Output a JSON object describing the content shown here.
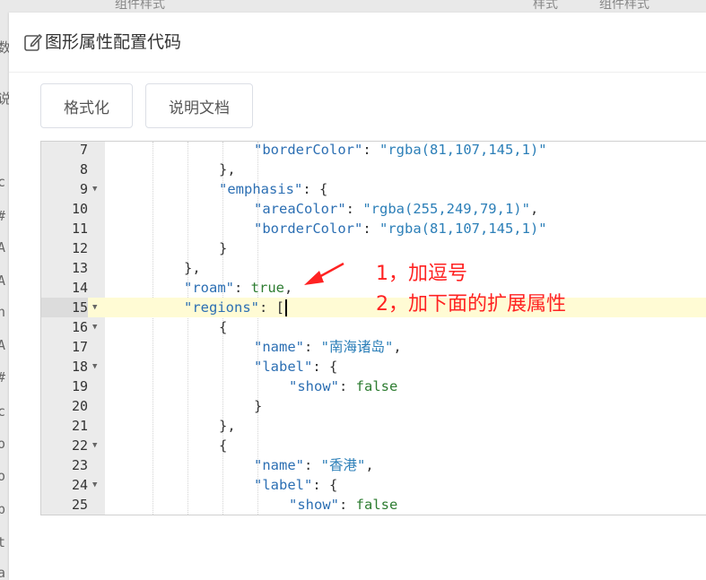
{
  "background": {
    "top_fragments": [
      "组件样式",
      "样式",
      "组件样式"
    ],
    "side_chars": [
      "数",
      "说",
      "c",
      "#",
      "A",
      "A",
      "n",
      "A",
      "#",
      "c",
      "o",
      "o",
      "p",
      "t",
      "a"
    ]
  },
  "dialog": {
    "title": "图形属性配置代码",
    "buttons": {
      "format": "格式化",
      "docs": "说明文档"
    }
  },
  "editor": {
    "active_line": 15,
    "lines": [
      {
        "num": "7",
        "fold": false,
        "parts": [
          [
            "k",
            "\"borderColor\""
          ],
          [
            "p",
            ": "
          ],
          [
            "v",
            "\"rgba(81,107,145,1)\""
          ]
        ],
        "indent": 16
      },
      {
        "num": "8",
        "fold": false,
        "parts": [
          [
            "p",
            "},"
          ]
        ],
        "indent": 12
      },
      {
        "num": "9",
        "fold": true,
        "parts": [
          [
            "k",
            "\"emphasis\""
          ],
          [
            "p",
            ": {"
          ]
        ],
        "indent": 12
      },
      {
        "num": "10",
        "fold": false,
        "parts": [
          [
            "k",
            "\"areaColor\""
          ],
          [
            "p",
            ": "
          ],
          [
            "v",
            "\"rgba(255,249,79,1)\""
          ],
          [
            "p",
            ","
          ]
        ],
        "indent": 16
      },
      {
        "num": "11",
        "fold": false,
        "parts": [
          [
            "k",
            "\"borderColor\""
          ],
          [
            "p",
            ": "
          ],
          [
            "v",
            "\"rgba(81,107,145,1)\""
          ]
        ],
        "indent": 16
      },
      {
        "num": "12",
        "fold": false,
        "parts": [
          [
            "p",
            "}"
          ]
        ],
        "indent": 12
      },
      {
        "num": "13",
        "fold": false,
        "parts": [
          [
            "p",
            "},"
          ]
        ],
        "indent": 8
      },
      {
        "num": "14",
        "fold": false,
        "parts": [
          [
            "k",
            "\"roam\""
          ],
          [
            "p",
            ": "
          ],
          [
            "b",
            "true"
          ],
          [
            "p",
            ","
          ]
        ],
        "indent": 8
      },
      {
        "num": "15",
        "fold": true,
        "parts": [
          [
            "k",
            "\"regions\""
          ],
          [
            "p",
            ": ["
          ]
        ],
        "indent": 8
      },
      {
        "num": "16",
        "fold": true,
        "parts": [
          [
            "p",
            "{"
          ]
        ],
        "indent": 12
      },
      {
        "num": "17",
        "fold": false,
        "parts": [
          [
            "k",
            "\"name\""
          ],
          [
            "p",
            ": "
          ],
          [
            "v",
            "\"南海诸岛\""
          ],
          [
            "p",
            ","
          ]
        ],
        "indent": 16
      },
      {
        "num": "18",
        "fold": true,
        "parts": [
          [
            "k",
            "\"label\""
          ],
          [
            "p",
            ": {"
          ]
        ],
        "indent": 16
      },
      {
        "num": "19",
        "fold": false,
        "parts": [
          [
            "k",
            "\"show\""
          ],
          [
            "p",
            ": "
          ],
          [
            "b",
            "false"
          ]
        ],
        "indent": 20
      },
      {
        "num": "20",
        "fold": false,
        "parts": [
          [
            "p",
            "}"
          ]
        ],
        "indent": 16
      },
      {
        "num": "21",
        "fold": false,
        "parts": [
          [
            "p",
            "},"
          ]
        ],
        "indent": 12
      },
      {
        "num": "22",
        "fold": true,
        "parts": [
          [
            "p",
            "{"
          ]
        ],
        "indent": 12
      },
      {
        "num": "23",
        "fold": false,
        "parts": [
          [
            "k",
            "\"name\""
          ],
          [
            "p",
            ": "
          ],
          [
            "v",
            "\"香港\""
          ],
          [
            "p",
            ","
          ]
        ],
        "indent": 16
      },
      {
        "num": "24",
        "fold": true,
        "parts": [
          [
            "k",
            "\"label\""
          ],
          [
            "p",
            ": {"
          ]
        ],
        "indent": 16
      },
      {
        "num": "25",
        "fold": false,
        "parts": [
          [
            "k",
            "\"show\""
          ],
          [
            "p",
            ": "
          ],
          [
            "b",
            "false"
          ]
        ],
        "indent": 20
      }
    ]
  },
  "annotation": {
    "color": "#ff2222",
    "line1": "1，加逗号",
    "line2": "2，加下面的扩展属性"
  }
}
